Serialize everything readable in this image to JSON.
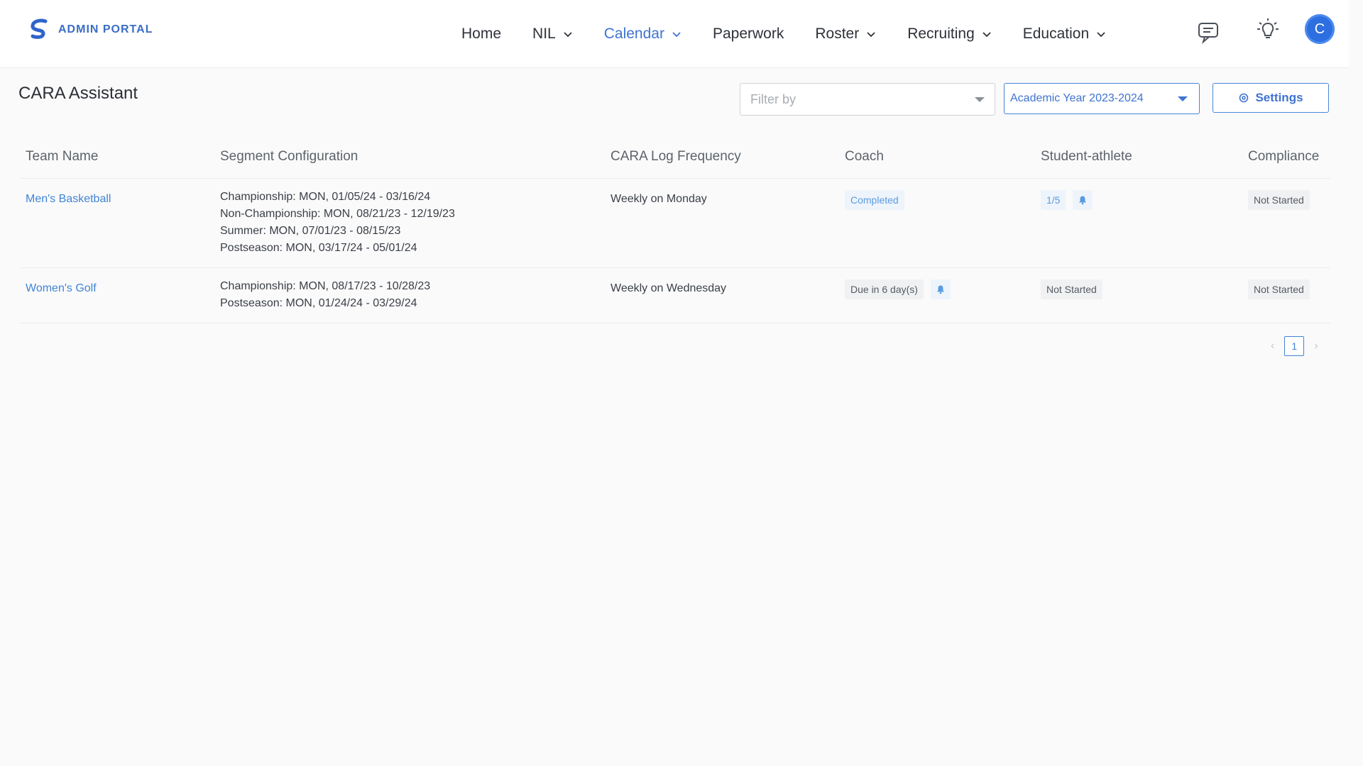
{
  "brand": {
    "name": "ADMIN PORTAL",
    "logo_icon": "s-logo-icon",
    "color": "#3b6dc5"
  },
  "nav": {
    "items": [
      {
        "label": "Home",
        "has_dropdown": false
      },
      {
        "label": "NIL",
        "has_dropdown": true
      },
      {
        "label": "Calendar",
        "has_dropdown": true,
        "active": true
      },
      {
        "label": "Paperwork",
        "has_dropdown": false
      },
      {
        "label": "Roster",
        "has_dropdown": true
      },
      {
        "label": "Recruiting",
        "has_dropdown": true
      },
      {
        "label": "Education",
        "has_dropdown": true
      }
    ],
    "icons": [
      "chat-icon",
      "lightbulb-icon"
    ],
    "avatar_letter": "C"
  },
  "page": {
    "title": "CARA Assistant",
    "filter_placeholder": "Filter by",
    "year_selected": "Academic Year 2023-2024",
    "settings_label": "Settings"
  },
  "table": {
    "headers": {
      "team": "Team Name",
      "segment": "Segment Configuration",
      "frequency": "CARA Log Frequency",
      "coach": "Coach",
      "student": "Student-athlete",
      "compliance": "Compliance"
    },
    "rows": [
      {
        "team": "Men's Basketball",
        "segments": [
          "Championship: MON, 01/05/24 - 03/16/24",
          "Non-Championship: MON, 08/21/23 - 12/19/23",
          "Summer: MON, 07/01/23 - 08/15/23",
          "Postseason: MON, 03/17/24 - 05/01/24"
        ],
        "frequency": "Weekly on Monday",
        "coach": "Completed",
        "student": "1/5",
        "compliance": "Not Started"
      },
      {
        "team": "Women's Golf",
        "segments": [
          "Championship: MON, 08/17/23 - 10/28/23",
          "Postseason: MON, 01/24/24 - 03/29/24"
        ],
        "frequency": "Weekly on Wednesday",
        "coach": "Due in 6 day(s)",
        "student": "Not Started",
        "compliance": "Not Started"
      }
    ]
  },
  "pagination": {
    "current_page": "1",
    "prev": "‹",
    "next": "›"
  },
  "colors": {
    "accent": "#3f73d1",
    "link": "#3f84d6",
    "badge_bg": "#f0f1f3"
  }
}
